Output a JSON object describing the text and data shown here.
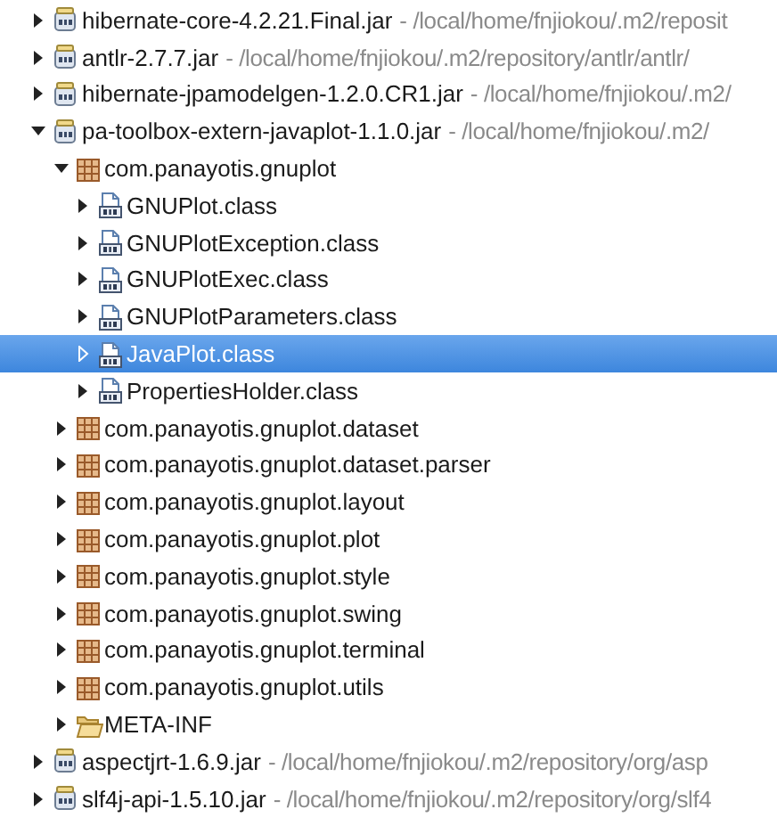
{
  "tree": [
    {
      "kind": "jar",
      "label": "hibernate-core-4.2.21.Final.jar",
      "location": "- /local/home/fnjiokou/.m2/reposit",
      "expanded": false,
      "selected": false
    },
    {
      "kind": "jar",
      "label": "antlr-2.7.7.jar",
      "location": "- /local/home/fnjiokou/.m2/repository/antlr/antlr/",
      "expanded": false,
      "selected": false
    },
    {
      "kind": "jar",
      "label": "hibernate-jpamodelgen-1.2.0.CR1.jar",
      "location": "- /local/home/fnjiokou/.m2/",
      "expanded": false,
      "selected": false
    },
    {
      "kind": "jar",
      "label": "pa-toolbox-extern-javaplot-1.1.0.jar",
      "location": "- /local/home/fnjiokou/.m2/",
      "expanded": true,
      "selected": false,
      "children": [
        {
          "kind": "package",
          "label": "com.panayotis.gnuplot",
          "expanded": true,
          "selected": false,
          "children": [
            {
              "kind": "class",
              "label": "GNUPlot.class",
              "expanded": false,
              "selected": false
            },
            {
              "kind": "class",
              "label": "GNUPlotException.class",
              "expanded": false,
              "selected": false
            },
            {
              "kind": "class",
              "label": "GNUPlotExec.class",
              "expanded": false,
              "selected": false
            },
            {
              "kind": "class",
              "label": "GNUPlotParameters.class",
              "expanded": false,
              "selected": false
            },
            {
              "kind": "class",
              "label": "JavaPlot.class",
              "expanded": false,
              "selected": true
            },
            {
              "kind": "class",
              "label": "PropertiesHolder.class",
              "expanded": false,
              "selected": false
            }
          ]
        },
        {
          "kind": "package",
          "label": "com.panayotis.gnuplot.dataset",
          "expanded": false,
          "selected": false
        },
        {
          "kind": "package",
          "label": "com.panayotis.gnuplot.dataset.parser",
          "expanded": false,
          "selected": false
        },
        {
          "kind": "package",
          "label": "com.panayotis.gnuplot.layout",
          "expanded": false,
          "selected": false
        },
        {
          "kind": "package",
          "label": "com.panayotis.gnuplot.plot",
          "expanded": false,
          "selected": false
        },
        {
          "kind": "package",
          "label": "com.panayotis.gnuplot.style",
          "expanded": false,
          "selected": false
        },
        {
          "kind": "package",
          "label": "com.panayotis.gnuplot.swing",
          "expanded": false,
          "selected": false
        },
        {
          "kind": "package",
          "label": "com.panayotis.gnuplot.terminal",
          "expanded": false,
          "selected": false
        },
        {
          "kind": "package",
          "label": "com.panayotis.gnuplot.utils",
          "expanded": false,
          "selected": false
        },
        {
          "kind": "folder",
          "label": "META-INF",
          "expanded": false,
          "selected": false
        }
      ]
    },
    {
      "kind": "jar",
      "label": "aspectjrt-1.6.9.jar",
      "location": "- /local/home/fnjiokou/.m2/repository/org/asp",
      "expanded": false,
      "selected": false
    },
    {
      "kind": "jar",
      "label": "slf4j-api-1.5.10.jar",
      "location": "- /local/home/fnjiokou/.m2/repository/org/slf4",
      "expanded": false,
      "selected": false
    }
  ]
}
